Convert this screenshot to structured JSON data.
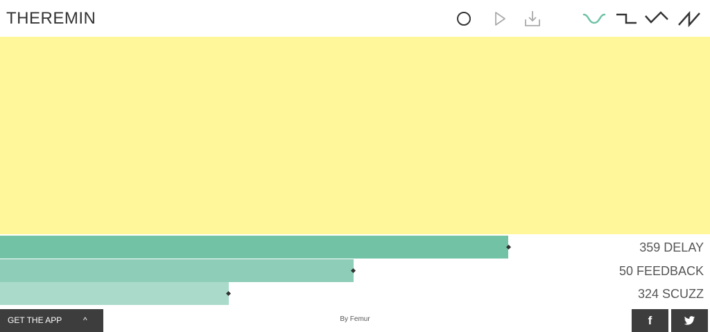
{
  "header": {
    "title": "THEREMIN",
    "icons": [
      "record-icon",
      "play-icon",
      "download-icon",
      "sine-wave-icon",
      "square-wave-icon",
      "triangle-wave-icon",
      "sawtooth-wave-icon"
    ],
    "selected_wave": "sine"
  },
  "colors": {
    "pad": "#fff799",
    "slider_1": "#72c2a5",
    "slider_2": "#8ecdb7",
    "slider_3": "#aadbca",
    "accent_wave": "#6fc2a6",
    "footer": "#3d3d3d"
  },
  "sliders": [
    {
      "value": "359",
      "label": "DELAY",
      "fill_percent": 71.6
    },
    {
      "value": "50",
      "label": "FEEDBACK",
      "fill_percent": 49.8
    },
    {
      "value": "324",
      "label": "SCUZZ",
      "fill_percent": 32.2
    }
  ],
  "footer": {
    "get_app_label": "GET THE APP",
    "get_app_caret": "^",
    "credit": "By Femur",
    "facebook_glyph": "f",
    "share_icons": [
      "facebook-icon",
      "twitter-icon"
    ]
  }
}
